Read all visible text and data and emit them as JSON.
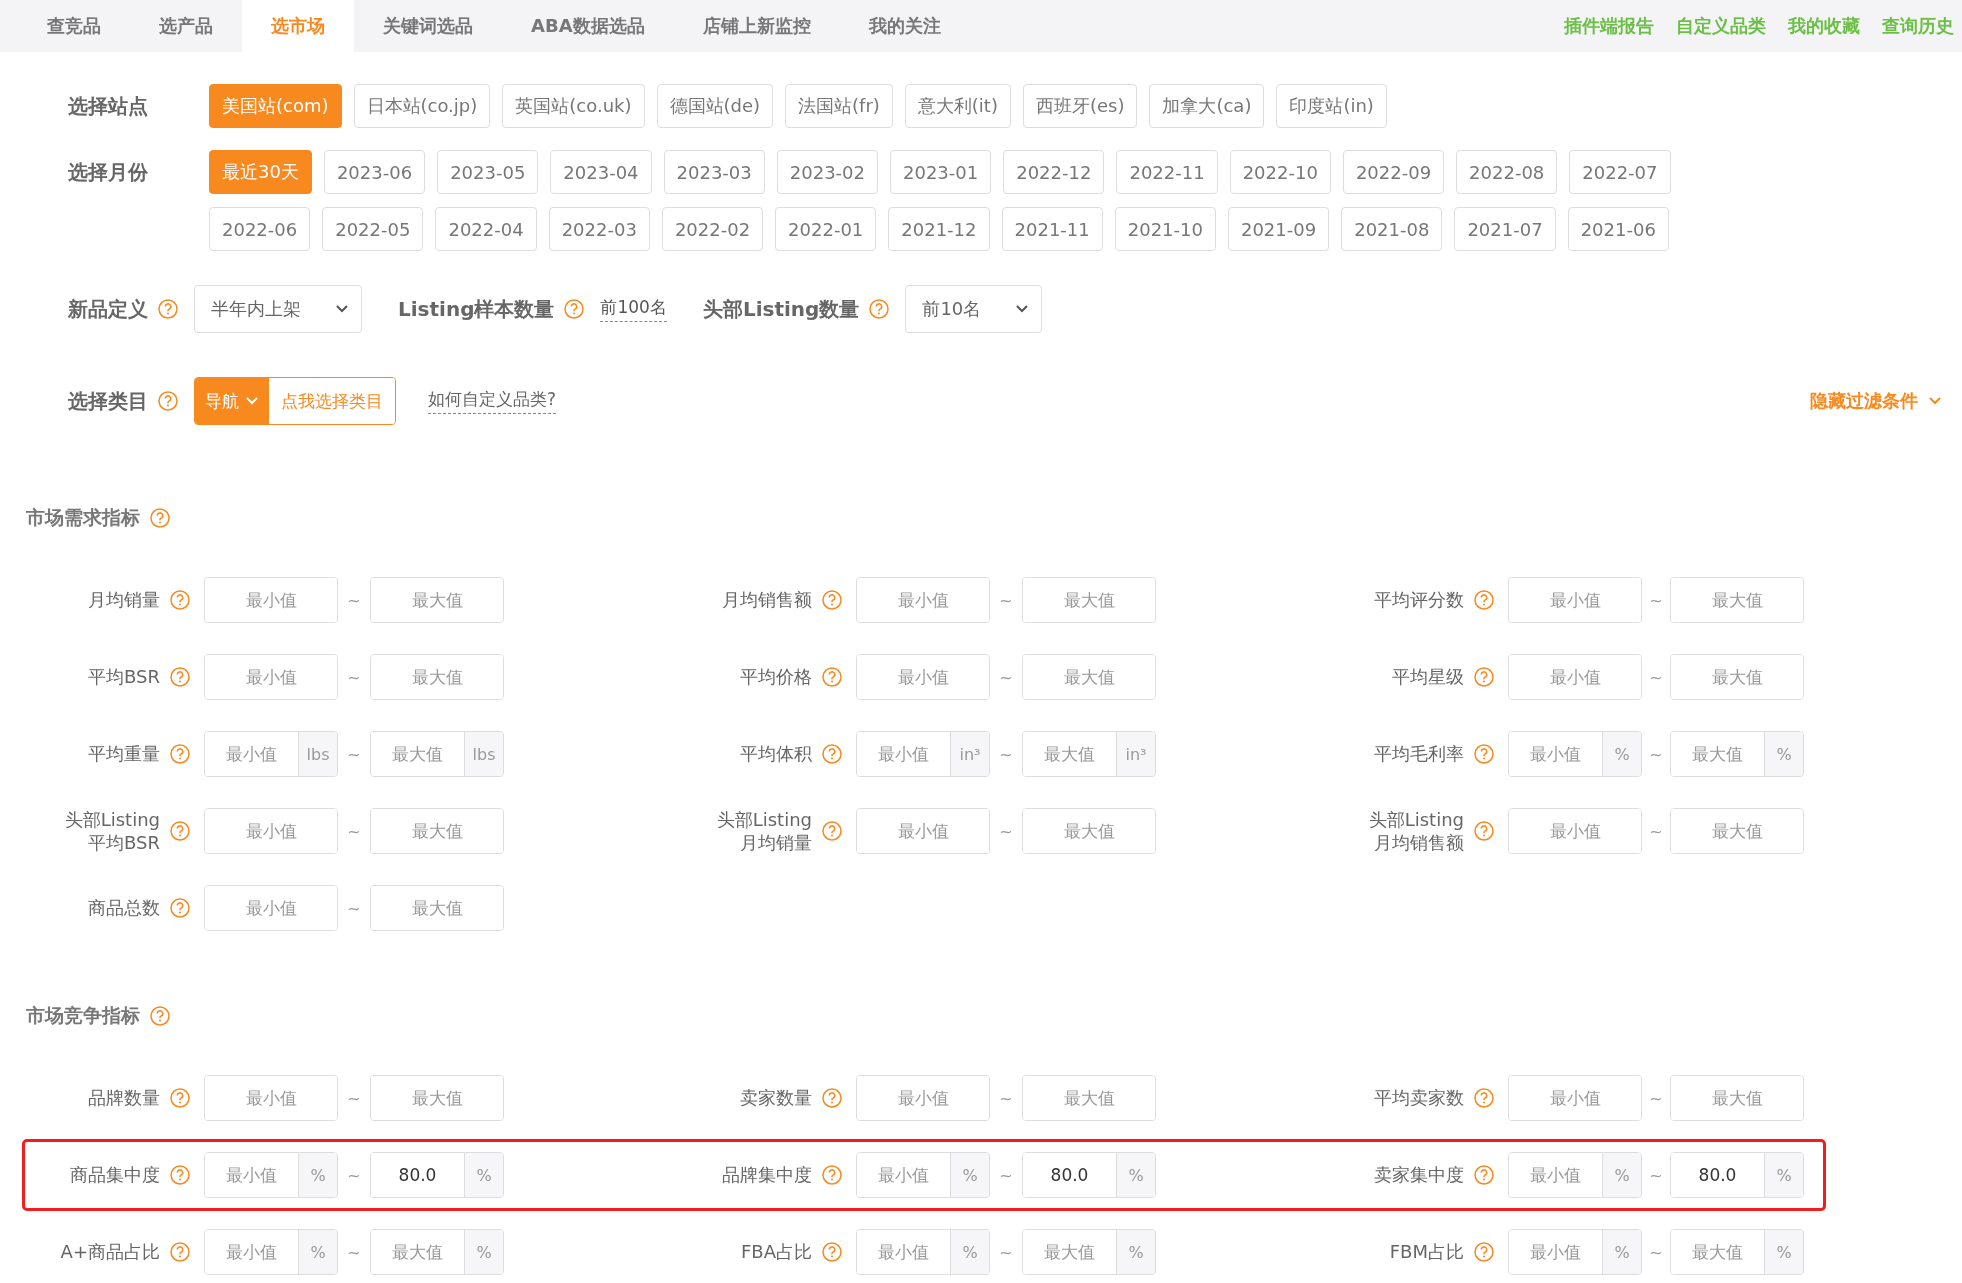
{
  "nav": {
    "tabs": [
      {
        "label": "查竞品",
        "selected": false
      },
      {
        "label": "选产品",
        "selected": false
      },
      {
        "label": "选市场",
        "selected": true
      },
      {
        "label": "关键词选品",
        "selected": false
      },
      {
        "label": "ABA数据选品",
        "selected": false
      },
      {
        "label": "店铺上新监控",
        "selected": false
      },
      {
        "label": "我的关注",
        "selected": false
      }
    ],
    "links": [
      "插件端报告",
      "自定义品类",
      "我的收藏",
      "查询历史"
    ]
  },
  "station": {
    "label": "选择站点",
    "options": [
      {
        "label": "美国站(com)",
        "selected": true
      },
      {
        "label": "日本站(co.jp)",
        "selected": false
      },
      {
        "label": "英国站(co.uk)",
        "selected": false
      },
      {
        "label": "德国站(de)",
        "selected": false
      },
      {
        "label": "法国站(fr)",
        "selected": false
      },
      {
        "label": "意大利(it)",
        "selected": false
      },
      {
        "label": "西班牙(es)",
        "selected": false
      },
      {
        "label": "加拿大(ca)",
        "selected": false
      },
      {
        "label": "印度站(in)",
        "selected": false
      }
    ]
  },
  "month": {
    "label": "选择月份",
    "rows": [
      [
        {
          "label": "最近30天",
          "selected": true
        },
        {
          "label": "2023-06",
          "selected": false
        },
        {
          "label": "2023-05",
          "selected": false
        },
        {
          "label": "2023-04",
          "selected": false
        },
        {
          "label": "2023-03",
          "selected": false
        },
        {
          "label": "2023-02",
          "selected": false
        },
        {
          "label": "2023-01",
          "selected": false
        },
        {
          "label": "2022-12",
          "selected": false
        },
        {
          "label": "2022-11",
          "selected": false
        },
        {
          "label": "2022-10",
          "selected": false
        },
        {
          "label": "2022-09",
          "selected": false
        },
        {
          "label": "2022-08",
          "selected": false
        },
        {
          "label": "2022-07",
          "selected": false
        }
      ],
      [
        {
          "label": "2022-06",
          "selected": false
        },
        {
          "label": "2022-05",
          "selected": false
        },
        {
          "label": "2022-04",
          "selected": false
        },
        {
          "label": "2022-03",
          "selected": false
        },
        {
          "label": "2022-02",
          "selected": false
        },
        {
          "label": "2022-01",
          "selected": false
        },
        {
          "label": "2021-12",
          "selected": false
        },
        {
          "label": "2021-11",
          "selected": false
        },
        {
          "label": "2021-10",
          "selected": false
        },
        {
          "label": "2021-09",
          "selected": false
        },
        {
          "label": "2021-08",
          "selected": false
        },
        {
          "label": "2021-07",
          "selected": false
        },
        {
          "label": "2021-06",
          "selected": false
        }
      ]
    ]
  },
  "settings": [
    {
      "kind": "select",
      "label": "新品定义",
      "value": "半年内上架"
    },
    {
      "kind": "text",
      "label": "Listing样本数量",
      "value": "前100名"
    },
    {
      "kind": "select",
      "label": "头部Listing数量",
      "value": "前10名"
    }
  ],
  "category": {
    "label": "选择类目",
    "nav_button": "导航",
    "choose_button": "点我选择类目",
    "link": "如何自定义品类?",
    "hide_filters": "隐藏过滤条件"
  },
  "range_separator": "~",
  "sections": [
    {
      "title": "市场需求指标",
      "rows": [
        {
          "highlighted": false,
          "fields": [
            {
              "label": "月均销量",
              "min": {
                "placeholder": "最小值"
              },
              "max": {
                "placeholder": "最大值"
              }
            },
            {
              "label": "月均销售额",
              "min": {
                "placeholder": "最小值"
              },
              "max": {
                "placeholder": "最大值"
              }
            },
            {
              "label": "平均评分数",
              "min": {
                "placeholder": "最小值"
              },
              "max": {
                "placeholder": "最大值"
              }
            }
          ]
        },
        {
          "highlighted": false,
          "fields": [
            {
              "label": "平均BSR",
              "min": {
                "placeholder": "最小值"
              },
              "max": {
                "placeholder": "最大值"
              }
            },
            {
              "label": "平均价格",
              "min": {
                "placeholder": "最小值"
              },
              "max": {
                "placeholder": "最大值"
              }
            },
            {
              "label": "平均星级",
              "min": {
                "placeholder": "最小值"
              },
              "max": {
                "placeholder": "最大值"
              }
            }
          ]
        },
        {
          "highlighted": false,
          "fields": [
            {
              "label": "平均重量",
              "min": {
                "placeholder": "最小值",
                "unit": "lbs"
              },
              "max": {
                "placeholder": "最大值",
                "unit": "lbs"
              }
            },
            {
              "label": "平均体积",
              "min": {
                "placeholder": "最小值",
                "unit": "in³"
              },
              "max": {
                "placeholder": "最大值",
                "unit": "in³"
              }
            },
            {
              "label": "平均毛利率",
              "min": {
                "placeholder": "最小值",
                "unit": "%"
              },
              "max": {
                "placeholder": "最大值",
                "unit": "%"
              }
            }
          ]
        },
        {
          "highlighted": false,
          "fields": [
            {
              "label": "头部Listing\n平均BSR",
              "min": {
                "placeholder": "最小值"
              },
              "max": {
                "placeholder": "最大值"
              }
            },
            {
              "label": "头部Listing\n月均销量",
              "min": {
                "placeholder": "最小值"
              },
              "max": {
                "placeholder": "最大值"
              }
            },
            {
              "label": "头部Listing\n月均销售额",
              "min": {
                "placeholder": "最小值"
              },
              "max": {
                "placeholder": "最大值"
              }
            }
          ]
        },
        {
          "highlighted": false,
          "fields": [
            {
              "label": "商品总数",
              "min": {
                "placeholder": "最小值"
              },
              "max": {
                "placeholder": "最大值"
              }
            }
          ]
        }
      ]
    },
    {
      "title": "市场竞争指标",
      "rows": [
        {
          "highlighted": false,
          "fields": [
            {
              "label": "品牌数量",
              "min": {
                "placeholder": "最小值"
              },
              "max": {
                "placeholder": "最大值"
              }
            },
            {
              "label": "卖家数量",
              "min": {
                "placeholder": "最小值"
              },
              "max": {
                "placeholder": "最大值"
              }
            },
            {
              "label": "平均卖家数",
              "min": {
                "placeholder": "最小值"
              },
              "max": {
                "placeholder": "最大值"
              }
            }
          ]
        },
        {
          "highlighted": true,
          "fields": [
            {
              "label": "商品集中度",
              "min": {
                "placeholder": "最小值",
                "unit": "%"
              },
              "max": {
                "value": "80.0",
                "unit": "%"
              }
            },
            {
              "label": "品牌集中度",
              "min": {
                "placeholder": "最小值",
                "unit": "%"
              },
              "max": {
                "value": "80.0",
                "unit": "%"
              }
            },
            {
              "label": "卖家集中度",
              "min": {
                "placeholder": "最小值",
                "unit": "%"
              },
              "max": {
                "value": "80.0",
                "unit": "%"
              }
            }
          ]
        },
        {
          "highlighted": false,
          "fields": [
            {
              "label": "A+商品占比",
              "min": {
                "placeholder": "最小值",
                "unit": "%"
              },
              "max": {
                "placeholder": "最大值",
                "unit": "%"
              }
            },
            {
              "label": "FBA占比",
              "min": {
                "placeholder": "最小值",
                "unit": "%"
              },
              "max": {
                "placeholder": "最大值",
                "unit": "%"
              }
            },
            {
              "label": "FBM占比",
              "min": {
                "placeholder": "最小值",
                "unit": "%"
              },
              "max": {
                "placeholder": "最大值",
                "unit": "%"
              }
            }
          ]
        }
      ]
    }
  ]
}
